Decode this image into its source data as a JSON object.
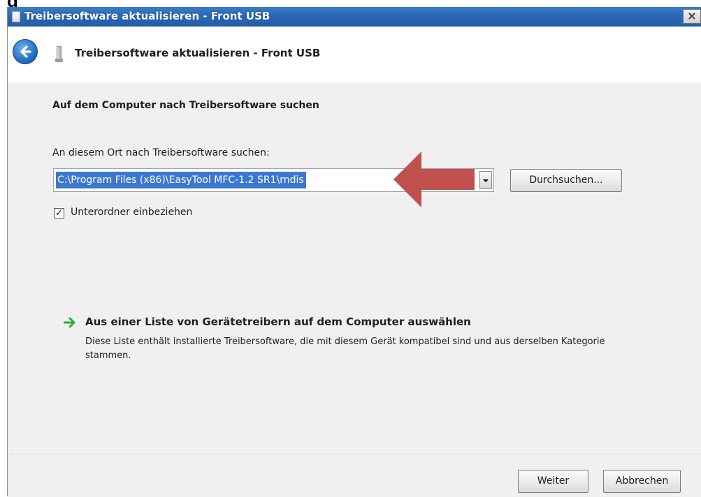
{
  "window": {
    "title": "Treibersoftware aktualisieren - Front USB",
    "close_label": "×"
  },
  "header": {
    "title": "Treibersoftware aktualisieren - Front USB"
  },
  "content": {
    "section_title": "Auf dem Computer nach Treibersoftware suchen",
    "path_label": "An diesem Ort nach Treibersoftware suchen:",
    "path_value": "C:\\Program Files (x86)\\EasyTool MFC-1.2 SR1\\rndis",
    "browse_label": "Durchsuchen...",
    "checkbox_checked": true,
    "checkbox_mark": "✓",
    "checkbox_label": "Unterordner einbeziehen",
    "list_option": {
      "title": "Aus einer Liste von Gerätetreibern auf dem Computer auswählen",
      "description": "Diese Liste enthält installierte Treibersoftware, die mit diesem Gerät kompatibel sind und aus derselben Kategorie stammen."
    }
  },
  "footer": {
    "next_label": "Weiter",
    "cancel_label": "Abbrechen"
  },
  "icons": {
    "back": "back-arrow-icon",
    "device": "usb-device-icon",
    "link": "green-arrow-icon",
    "annotation": "red-arrow-icon"
  },
  "colors": {
    "titlebar": "#2b68b8",
    "selection": "#3a78cf",
    "annotation_arrow": "#c0504d",
    "link_arrow": "#2fb02f"
  }
}
